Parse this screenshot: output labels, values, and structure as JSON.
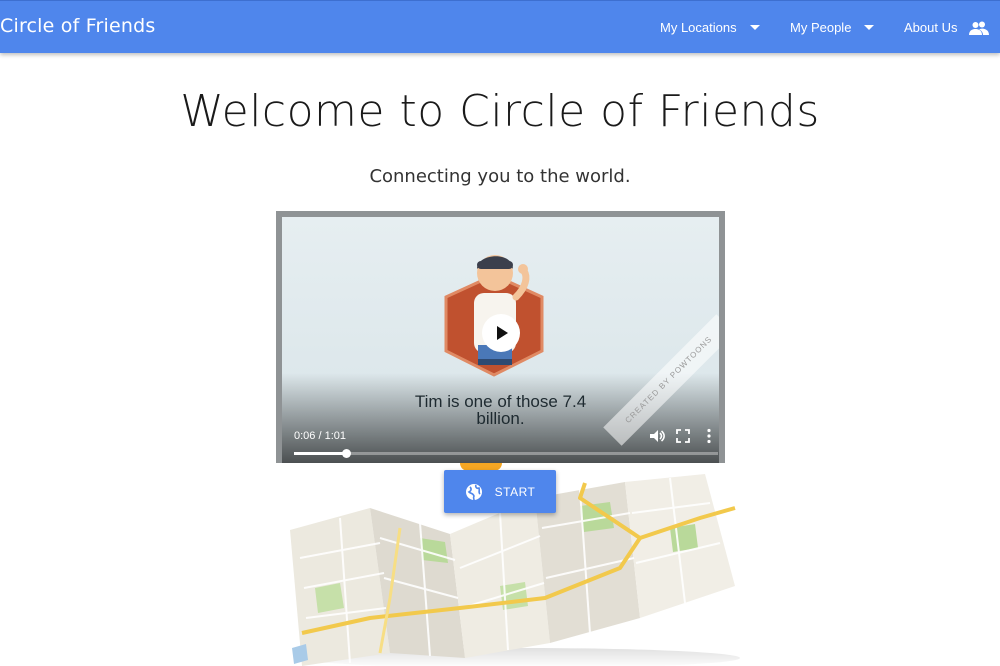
{
  "navbar": {
    "brand": "Circle of Friends",
    "items": [
      {
        "label": "My Locations",
        "has_dropdown": true
      },
      {
        "label": "My People",
        "has_dropdown": true
      },
      {
        "label": "About Us",
        "icon": "people-icon"
      }
    ],
    "color": "#4f86ec"
  },
  "hero": {
    "title": "Welcome to Circle of Friends",
    "subtitle": "Connecting you to the world."
  },
  "video": {
    "caption_line1": "Tim is one of those 7.4",
    "caption_line2": "billion.",
    "time": "0:06 / 1:01",
    "progress_fraction": 0.123,
    "watermark": "CREATED BY POWTOONS"
  },
  "start_button": {
    "label": "START",
    "icon": "globe-icon"
  }
}
